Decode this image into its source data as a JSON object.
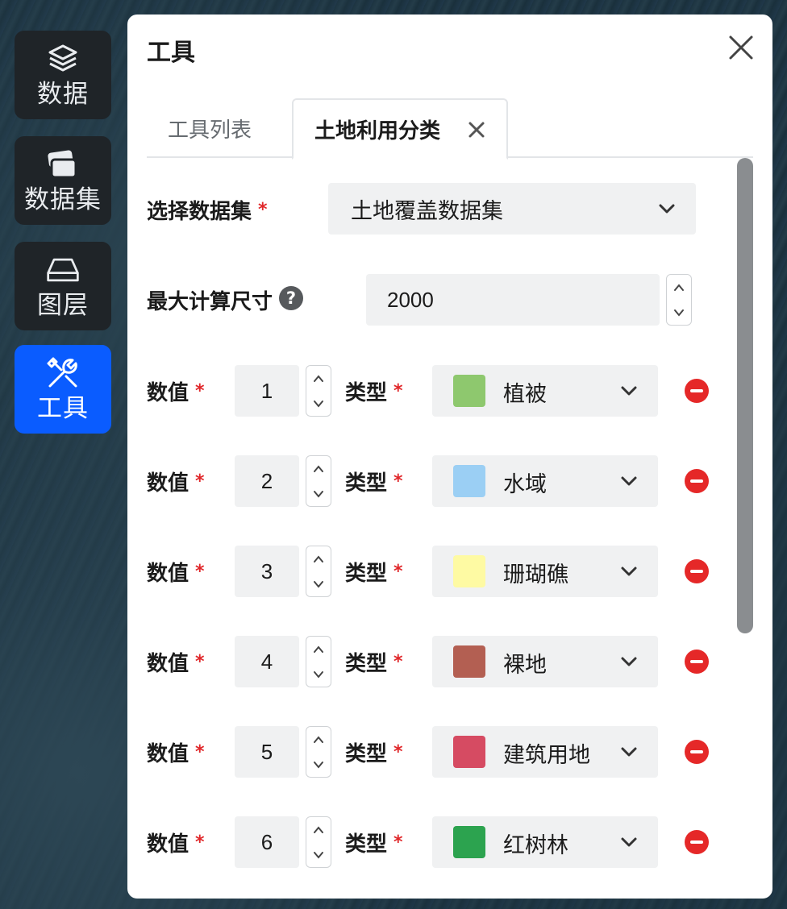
{
  "rail": [
    {
      "label": "数据",
      "icon": "layers-icon",
      "active": false
    },
    {
      "label": "数据集",
      "icon": "cards-icon",
      "active": false
    },
    {
      "label": "图层",
      "icon": "layer-plane-icon",
      "active": false
    },
    {
      "label": "工具",
      "icon": "tools-icon",
      "active": true
    }
  ],
  "panel": {
    "title": "工具",
    "tabs": [
      {
        "label": "工具列表",
        "active": false
      },
      {
        "label": "土地利用分类",
        "active": true
      }
    ],
    "dataset": {
      "label": "选择数据集",
      "required": "*",
      "value": "土地覆盖数据集"
    },
    "max_size": {
      "label": "最大计算尺寸",
      "help": "?",
      "value": "2000"
    },
    "rows": [
      {
        "value_label": "数值",
        "req": "*",
        "value": "1",
        "type_label": "类型",
        "type": "植被",
        "color": "#8ec86e"
      },
      {
        "value_label": "数值",
        "req": "*",
        "value": "2",
        "type_label": "类型",
        "type": "水域",
        "color": "#9bcff4"
      },
      {
        "value_label": "数值",
        "req": "*",
        "value": "3",
        "type_label": "类型",
        "type": "珊瑚礁",
        "color": "#fefaa3"
      },
      {
        "value_label": "数值",
        "req": "*",
        "value": "4",
        "type_label": "类型",
        "type": "裸地",
        "color": "#b35f52"
      },
      {
        "value_label": "数值",
        "req": "*",
        "value": "5",
        "type_label": "类型",
        "type": "建筑用地",
        "color": "#d64b62"
      },
      {
        "value_label": "数值",
        "req": "*",
        "value": "6",
        "type_label": "类型",
        "type": "红树林",
        "color": "#2ca34f"
      }
    ]
  }
}
